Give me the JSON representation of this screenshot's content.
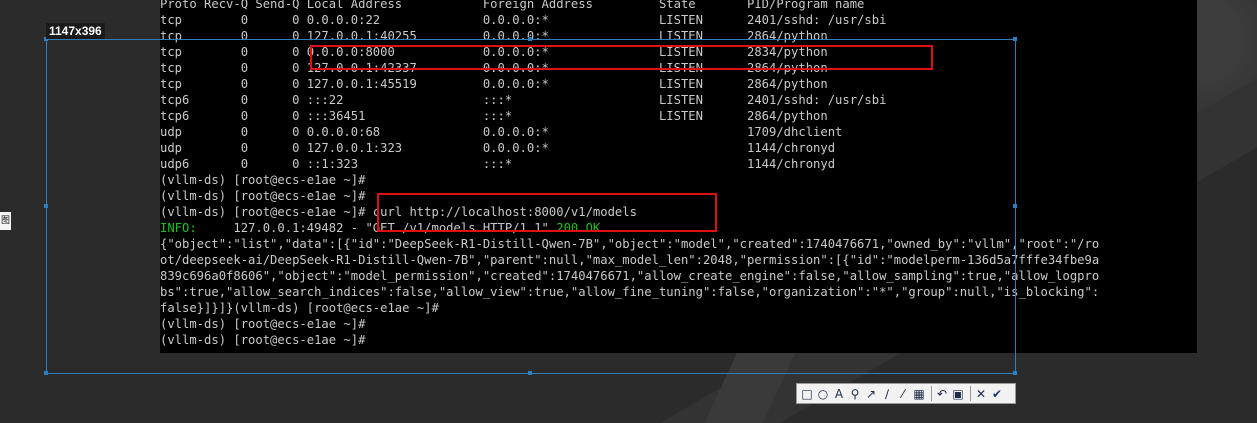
{
  "selection": {
    "size_label": "1147x396"
  },
  "side_tag": {
    "label": "图"
  },
  "terminal": {
    "lines": [
      "Proto Recv-Q Send-Q Local Address           Foreign Address         State       PID/Program name",
      "tcp        0      0 0.0.0.0:22              0.0.0.0:*               LISTEN      2401/sshd: /usr/sbi",
      "tcp        0      0 127.0.0.1:40255         0.0.0.0:*               LISTEN      2864/python",
      "tcp        0      0 0.0.0.0:8000            0.0.0.0:*               LISTEN      2834/python",
      "tcp        0      0 127.0.0.1:42337         0.0.0.0:*               LISTEN      2864/python",
      "tcp        0      0 127.0.0.1:45519         0.0.0.0:*               LISTEN      2864/python",
      "tcp6       0      0 :::22                   :::*                    LISTEN      2401/sshd: /usr/sbi",
      "tcp6       0      0 :::36451                :::*                    LISTEN      2864/python",
      "udp        0      0 0.0.0.0:68              0.0.0.0:*                           1709/dhclient",
      "udp        0      0 127.0.0.1:323           0.0.0.0:*                           1144/chronyd",
      "udp6       0      0 ::1:323                 :::*                                1144/chronyd",
      "(vllm-ds) [root@ecs-e1ae ~]#",
      "(vllm-ds) [root@ecs-e1ae ~]#",
      "(vllm-ds) [root@ecs-e1ae ~]# curl http://localhost:8000/v1/models",
      "",
      "{\"object\":\"list\",\"data\":[{\"id\":\"DeepSeek-R1-Distill-Qwen-7B\",\"object\":\"model\",\"created\":1740476671,\"owned_by\":\"vllm\",\"root\":\"/ro",
      "ot/deepseek-ai/DeepSeek-R1-Distill-Qwen-7B\",\"parent\":null,\"max_model_len\":2048,\"permission\":[{\"id\":\"modelperm-136d5a7fffe34fbe9a",
      "839c696a0f8606\",\"object\":\"model_permission\",\"created\":1740476671,\"allow_create_engine\":false,\"allow_sampling\":true,\"allow_logpro",
      "bs\":true,\"allow_search_indices\":false,\"allow_view\":true,\"allow_fine_tuning\":false,\"organization\":\"*\",\"group\":null,\"is_blocking\":",
      "false}]}]}(vllm-ds) [root@ecs-e1ae ~]#",
      "(vllm-ds) [root@ecs-e1ae ~]#",
      "(vllm-ds) [root@ecs-e1ae ~]#"
    ],
    "info_line": {
      "level": "INFO:",
      "rest": "     127.0.0.1:49482 - \"GET /v1/models HTTP/1.1\" ",
      "status": "200 OK"
    }
  },
  "toolbar": {
    "tools": [
      {
        "name": "rectangle-tool-icon",
        "glyph": "□"
      },
      {
        "name": "ellipse-tool-icon",
        "glyph": "○"
      },
      {
        "name": "text-tool-icon",
        "glyph": "A"
      },
      {
        "name": "pin-tool-icon",
        "glyph": "⚲"
      },
      {
        "name": "arrow-tool-icon",
        "glyph": "↗"
      },
      {
        "name": "line-tool-icon",
        "glyph": "∕"
      },
      {
        "name": "pen-tool-icon",
        "glyph": "⁄"
      },
      {
        "name": "mosaic-tool-icon",
        "glyph": "▦"
      }
    ],
    "actions": [
      {
        "name": "undo-icon",
        "glyph": "↶"
      },
      {
        "name": "save-icon",
        "glyph": "▣"
      }
    ],
    "close_glyph": "✕",
    "confirm_glyph": "✔"
  },
  "colors": {
    "highlight": "#e01010",
    "selection": "#2f7fbf",
    "info_green": "#19c419"
  }
}
